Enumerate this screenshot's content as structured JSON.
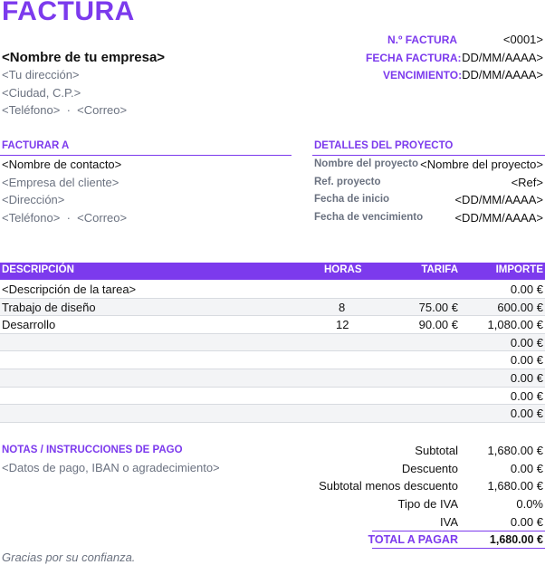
{
  "header": {
    "title": "FACTURA",
    "company_name": "<Nombre de tu empresa>",
    "address": "<Tu dirección>",
    "city": "<Ciudad, C.P.>",
    "phone": "<Teléfono>",
    "separator": "·",
    "email": "<Correo>"
  },
  "invoice_meta": {
    "number_label": "N.º FACTURA",
    "number_value": "<0001>",
    "date_label": "FECHA FACTURA:",
    "date_value": "DD/MM/AAAA>",
    "due_label": "VENCIMIENTO:",
    "due_value": "DD/MM/AAAA>"
  },
  "bill_to": {
    "heading": "FACTURAR A",
    "contact": "<Nombre de contacto>",
    "company": "<Empresa del cliente>",
    "address": "<Dirección>",
    "phone": "<Teléfono>",
    "separator": "·",
    "email": "<Correo>"
  },
  "project": {
    "heading": "DETALLES DEL PROYECTO",
    "rows": [
      {
        "label": "Nombre del proyecto",
        "value": "<Nombre del proyecto>"
      },
      {
        "label": "Ref. proyecto",
        "value": "<Ref>"
      },
      {
        "label": "Fecha de inicio",
        "value": "<DD/MM/AAAA>"
      },
      {
        "label": "Fecha de vencimiento",
        "value": "<DD/MM/AAAA>"
      }
    ]
  },
  "items": {
    "columns": {
      "description": "DESCRIPCIÓN",
      "hours": "HORAS",
      "rate": "TARIFA",
      "amount": "IMPORTE"
    },
    "rows": [
      {
        "description": "<Descripción de la tarea>",
        "hours": "",
        "rate": "",
        "amount": "0.00 €"
      },
      {
        "description": "Trabajo de diseño",
        "hours": "8",
        "rate": "75.00 €",
        "amount": "600.00 €"
      },
      {
        "description": "Desarrollo",
        "hours": "12",
        "rate": "90.00 €",
        "amount": "1,080.00 €"
      },
      {
        "description": "",
        "hours": "",
        "rate": "",
        "amount": "0.00 €"
      },
      {
        "description": "",
        "hours": "",
        "rate": "",
        "amount": "0.00 €"
      },
      {
        "description": "",
        "hours": "",
        "rate": "",
        "amount": "0.00 €"
      },
      {
        "description": "",
        "hours": "",
        "rate": "",
        "amount": "0.00 €"
      },
      {
        "description": "",
        "hours": "",
        "rate": "",
        "amount": "0.00 €"
      }
    ]
  },
  "notes": {
    "heading": "NOTAS / INSTRUCCIONES DE PAGO",
    "text": "<Datos de pago, IBAN o agradecimiento>"
  },
  "totals": {
    "rows": [
      {
        "label": "Subtotal",
        "value": "1,680.00 €"
      },
      {
        "label": "Descuento",
        "value": "0.00 €"
      },
      {
        "label": "Subtotal menos descuento",
        "value": "1,680.00 €"
      },
      {
        "label": "Tipo de IVA",
        "value": "0.0%"
      },
      {
        "label": "IVA",
        "value": "0.00 €"
      }
    ],
    "total_label": "TOTAL A PAGAR",
    "total_value": "1,680.00 €"
  },
  "footer": {
    "thanks": "Gracias por su confianza."
  },
  "colors": {
    "accent": "#7c3aed",
    "muted": "#6b7280",
    "row_alt": "#f3f4f6"
  }
}
